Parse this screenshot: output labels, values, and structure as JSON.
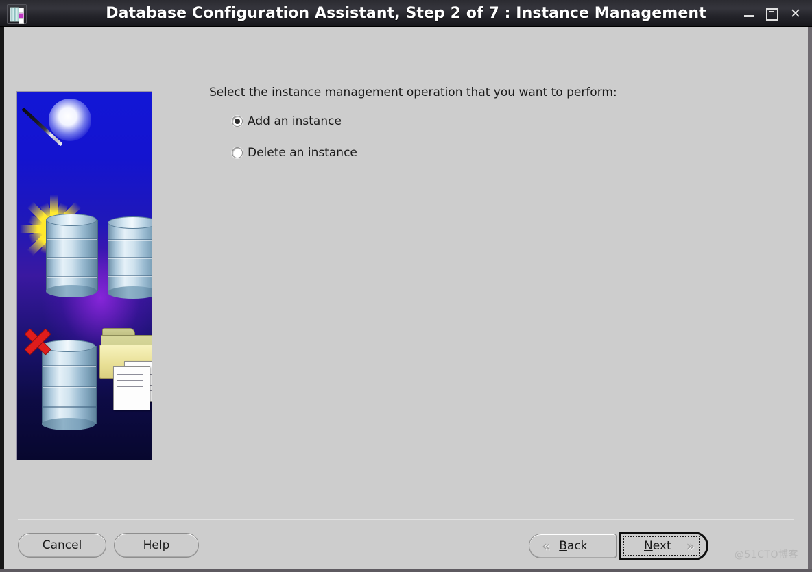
{
  "window": {
    "title": "Database Configuration Assistant, Step 2 of 7 : Instance Management",
    "icon_name": "database-app-icon",
    "controls": {
      "minimize": "minimize-icon",
      "maximize": "maximize-icon",
      "close": "close-icon"
    },
    "titlebar_color": "#2b2b31",
    "body_color": "#cdcdcd"
  },
  "main": {
    "prompt": "Select the instance management operation that you want to perform:",
    "options": [
      {
        "label": "Add an instance",
        "selected": true
      },
      {
        "label": "Delete an instance",
        "selected": false
      }
    ],
    "illustration": {
      "name": "wizard-database-illustration",
      "background_color": "#1216d6",
      "accent_color": "#d0191f"
    }
  },
  "footer": {
    "cancel_label": "Cancel",
    "help_label": "Help",
    "back": {
      "label": "Back",
      "mnemonic": "B",
      "prefix": "",
      "suffix": "ack",
      "chevron": "«"
    },
    "next": {
      "label": "Next",
      "mnemonic": "N",
      "prefix": "",
      "suffix": "ext",
      "chevron": "»",
      "focused": true
    }
  },
  "watermark": "@51CTO博客"
}
